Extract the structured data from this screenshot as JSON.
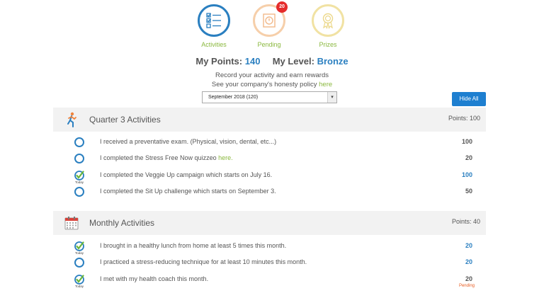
{
  "nav": {
    "activities": {
      "label": "Activities"
    },
    "pending": {
      "label": "Pending",
      "badge": "20"
    },
    "prizes": {
      "label": "Prizes"
    }
  },
  "summary": {
    "points_label": "My Points:",
    "points_value": "140",
    "level_label": "My Level:",
    "level_value": "Bronze",
    "line1": "Record your activity and earn rewards",
    "line2_prefix": "See your company's honesty policy",
    "line2_link": "here"
  },
  "month_select": {
    "value": "September 2018 (120)"
  },
  "hide_all_label": "Hide All",
  "sections": [
    {
      "title": "Quarter 3 Activities",
      "points": "Points: 100",
      "icon": "running-person-icon",
      "rows": [
        {
          "text": "I received a preventative exam. (Physical, vision, dental, etc...)",
          "link": "",
          "points": "100",
          "done": false
        },
        {
          "text": "I completed the Stress Free Now quizzeo",
          "link": "here.",
          "points": "20",
          "done": false
        },
        {
          "text": "I completed the Veggie Up campaign which starts on July 16.",
          "link": "",
          "points": "100",
          "done": true,
          "today": "Today"
        },
        {
          "text": "I completed the Sit Up challenge which starts on September 3.",
          "link": "",
          "points": "50",
          "done": false
        }
      ]
    },
    {
      "title": "Monthly Activities",
      "points": "Points: 40",
      "icon": "calendar-icon",
      "rows": [
        {
          "text": "I brought in a healthy lunch from home at least 5 times this month.",
          "points": "20",
          "done": true,
          "today": "Today"
        },
        {
          "text": "I practiced a stress-reducing technique for at least 10 minutes this month.",
          "points": "20",
          "done": false
        },
        {
          "text": "I met with my health coach this month.",
          "points": "20",
          "done": true,
          "today": "Today",
          "status": "Pending"
        }
      ]
    }
  ],
  "colors": {
    "accent": "#2a7fc0",
    "green": "#8ab83e",
    "button": "#1e7fd0",
    "badge": "#e52b2b",
    "pending": "#e85c20"
  }
}
